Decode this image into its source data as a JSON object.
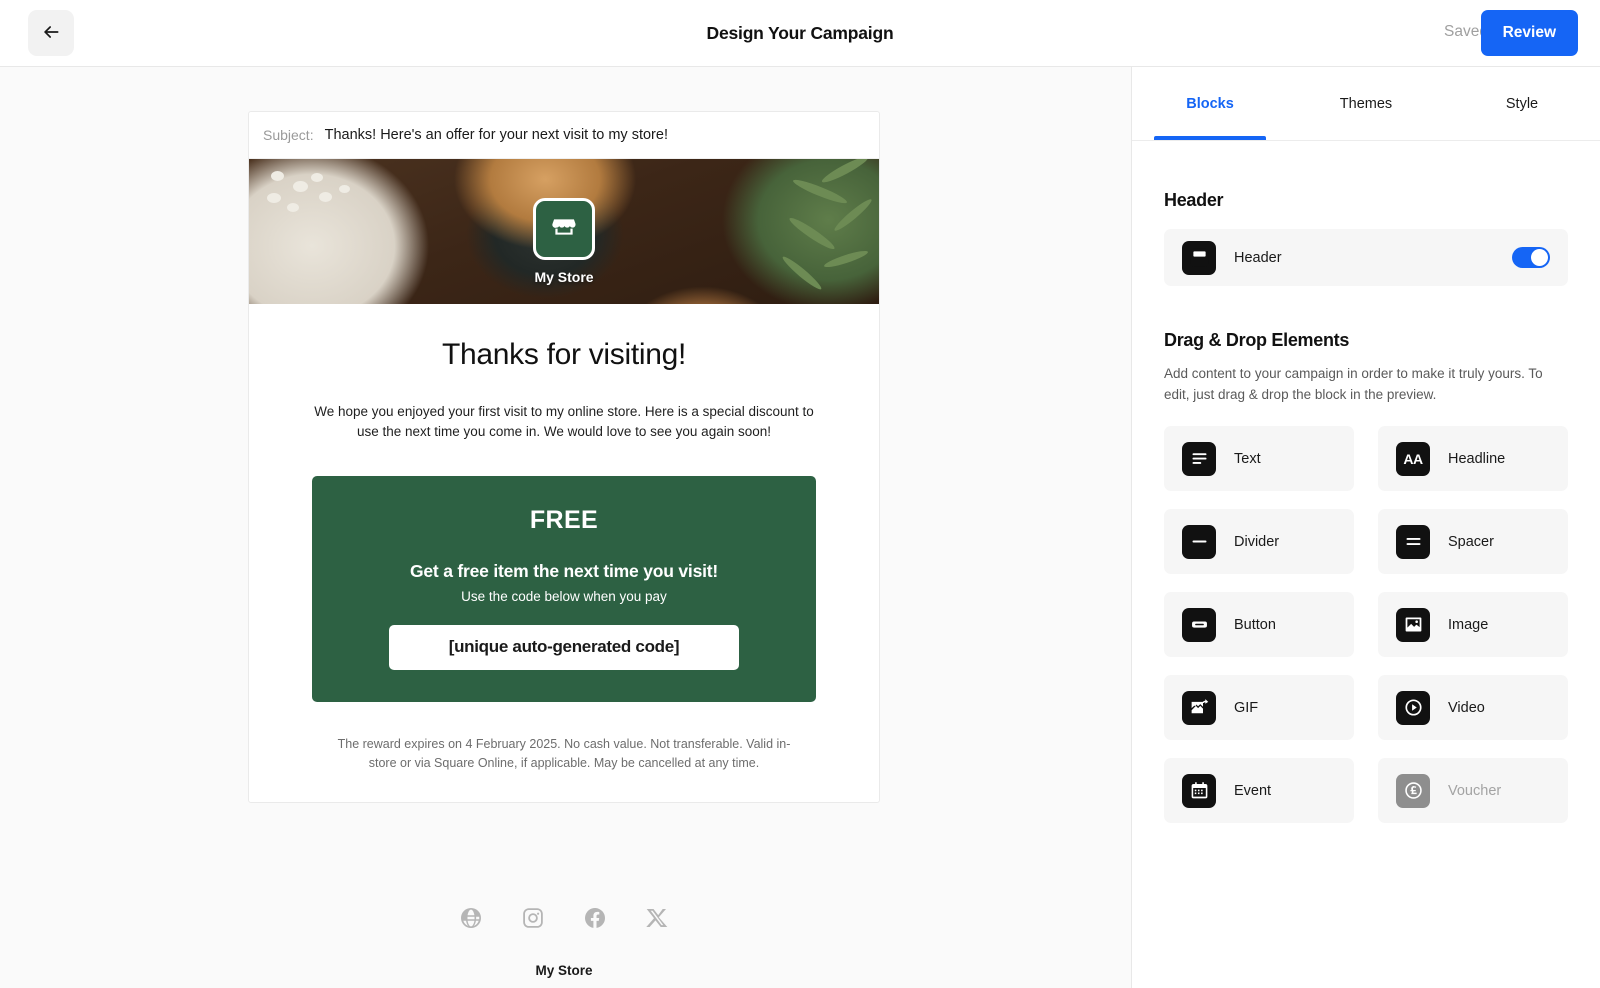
{
  "topbar": {
    "back_icon": "arrow-left-icon",
    "title": "Design Your Campaign",
    "saved_label": "Saved",
    "review_label": "Review"
  },
  "preview": {
    "subject_label": "Subject:",
    "subject_value": "Thanks! Here's an offer for your next visit to my store!",
    "logo_icon": "storefront-icon",
    "store_name": "My Store",
    "heading": "Thanks for visiting!",
    "intro": "We hope you enjoyed your first visit to my online store. Here is a special discount to use the next time you come in. We would love to see you again soon!",
    "offer": {
      "free_label": "FREE",
      "headline": "Get a free item the next time you visit!",
      "subtext": "Use the code below when you pay",
      "code_placeholder": "[unique auto-generated code]",
      "background_color": "#2d6143"
    },
    "fine_print": "The reward expires on 4 February 2025. No cash value. Not transferable. Valid in-store or via Square Online, if applicable. May be cancelled at any time.",
    "footer": {
      "social_icons": [
        "globe-icon",
        "instagram-icon",
        "facebook-icon",
        "x-twitter-icon"
      ],
      "store_name": "My Store"
    }
  },
  "panel": {
    "tabs": [
      {
        "label": "Blocks",
        "active": true
      },
      {
        "label": "Themes",
        "active": false
      },
      {
        "label": "Style",
        "active": false
      }
    ],
    "header_section": {
      "title": "Header",
      "row_label": "Header",
      "row_icon": "header-block-icon",
      "toggle_on": true
    },
    "elements_section": {
      "title": "Drag & Drop Elements",
      "description": "Add content to your campaign in order to make it truly yours. To edit, just drag & drop the block in the preview.",
      "items": [
        {
          "label": "Text",
          "icon": "text-lines-icon",
          "disabled": false
        },
        {
          "label": "Headline",
          "icon": "aa-icon",
          "disabled": false
        },
        {
          "label": "Divider",
          "icon": "divider-icon",
          "disabled": false
        },
        {
          "label": "Spacer",
          "icon": "spacer-icon",
          "disabled": false
        },
        {
          "label": "Button",
          "icon": "button-icon",
          "disabled": false
        },
        {
          "label": "Image",
          "icon": "image-icon",
          "disabled": false
        },
        {
          "label": "GIF",
          "icon": "gif-icon",
          "disabled": false
        },
        {
          "label": "Video",
          "icon": "play-circle-icon",
          "disabled": false
        },
        {
          "label": "Event",
          "icon": "calendar-icon",
          "disabled": false
        },
        {
          "label": "Voucher",
          "icon": "pound-coin-icon",
          "disabled": true
        }
      ]
    }
  },
  "colors": {
    "accent_blue": "#1565f5",
    "brand_green": "#2d6143"
  }
}
